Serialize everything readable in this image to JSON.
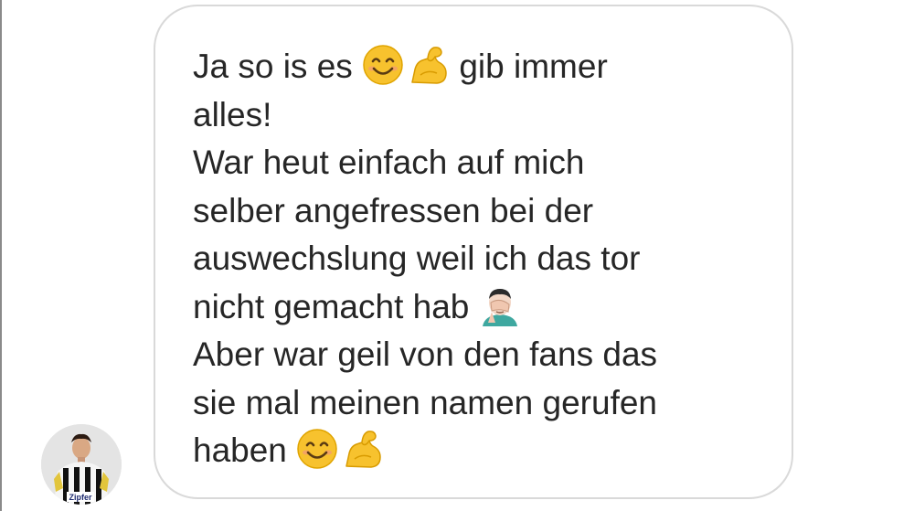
{
  "conversation": {
    "avatar": {
      "label": "Zipfer"
    },
    "message": {
      "lines": [
        {
          "text": "Ja so is es ",
          "emojis": [
            "smiling-face",
            "flexed-biceps"
          ],
          "after": " gib immer"
        },
        {
          "text": "alles!"
        },
        {
          "text": "War heut einfach auf mich"
        },
        {
          "text": "selber angefressen bei der"
        },
        {
          "text": "auswechslung weil ich das tor"
        },
        {
          "text": "nicht gemacht hab ",
          "emojis": [
            "man-facepalming"
          ]
        },
        {
          "text": "Aber war geil von den fans das"
        },
        {
          "text": "sie mal meinen namen gerufen"
        },
        {
          "text": "haben ",
          "emojis": [
            "smiling-face",
            "flexed-biceps"
          ]
        }
      ]
    }
  },
  "colors": {
    "text": "#262626",
    "bubble_border": "#d9d9d9",
    "emoji_yellow": "#f7c22e"
  }
}
